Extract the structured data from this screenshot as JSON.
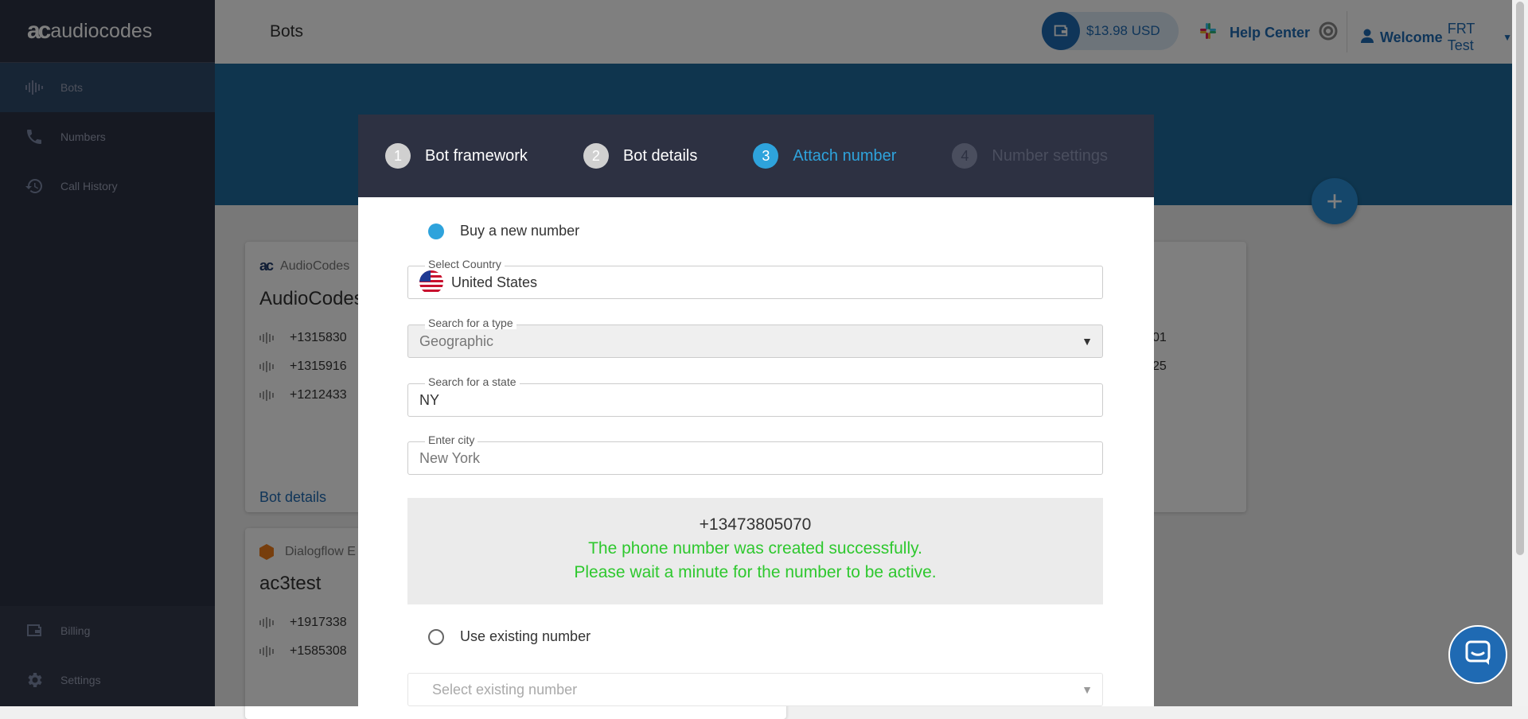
{
  "app": {
    "logo_text": "audiocodes"
  },
  "sidebar": {
    "items": [
      {
        "label": "Bots",
        "icon": "waveform-icon"
      },
      {
        "label": "Numbers",
        "icon": "phone-icon"
      },
      {
        "label": "Call History",
        "icon": "history-icon"
      }
    ],
    "bottom_items": [
      {
        "label": "Billing",
        "icon": "wallet-icon"
      },
      {
        "label": "Settings",
        "icon": "gear-icon"
      }
    ]
  },
  "header": {
    "page_title": "Bots",
    "balance": "$13.98 USD",
    "help_center": "Help Center",
    "welcome": "Welcome",
    "user_name": "FRT Test"
  },
  "cards": [
    {
      "brand": "AudioCodes",
      "title": "AudioCodes",
      "numbers": [
        "+1315830",
        "+1315916",
        "+1212433"
      ],
      "right_numbers": [
        "01",
        "25"
      ],
      "link": "Bot details"
    },
    {
      "brand": "Dialogflow E",
      "title": "ac3test",
      "numbers": [
        "+1917338",
        "+1585308"
      ]
    }
  ],
  "wizard": {
    "steps": [
      {
        "num": "1",
        "label": "Bot framework",
        "state": "done"
      },
      {
        "num": "2",
        "label": "Bot details",
        "state": "done"
      },
      {
        "num": "3",
        "label": "Attach number",
        "state": "current"
      },
      {
        "num": "4",
        "label": "Number settings",
        "state": "todo"
      }
    ],
    "buy_new_label": "Buy a new number",
    "country_label": "Select Country",
    "country_value": "United States",
    "type_label": "Search for a type",
    "type_value": "Geographic",
    "state_label": "Search for a state",
    "state_value": "NY",
    "city_label": "Enter city",
    "city_value": "New York",
    "created_number": "+13473805070",
    "success_line1": "The phone number was created successfully.",
    "success_line2": "Please wait a minute for the number to be active.",
    "use_existing_label": "Use existing number",
    "existing_placeholder": "Select existing number"
  },
  "colors": {
    "accent": "#2ea3dc",
    "brand_blue": "#1f6ab3",
    "success": "#2ec82e",
    "sidebar_bg": "#2c3244",
    "modal_header_bg": "#2d3142"
  }
}
